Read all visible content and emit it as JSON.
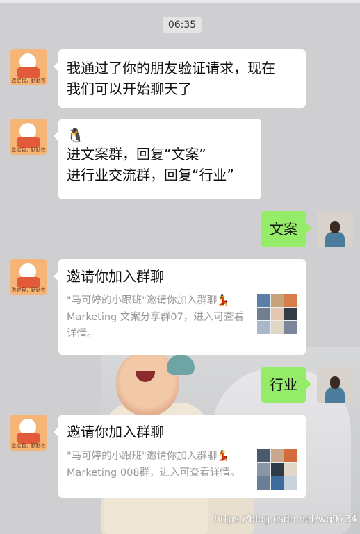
{
  "timestamp": "06:35",
  "messages": {
    "m1": {
      "line1": "我通过了你的朋友验证请求，现在",
      "line2": "我们可以开始聊天了"
    },
    "m2": {
      "emoji": "🐧",
      "line1": "进文案群，回复“文案”",
      "line2": "进行业交流群，回复“行业”"
    },
    "m3": {
      "text": "文案"
    },
    "m4": {
      "title": "邀请你加入群聊",
      "line1": "\"马可婷的小跟班\"邀请你加入群聊💃",
      "line2": "Marketing 文案分享群07，进入可查看",
      "line3": "详情。"
    },
    "m5": {
      "text": "行业"
    },
    "m6": {
      "title": "邀请你加入群聊",
      "line1": "\"马可婷的小跟班\"邀请你加入群聊💃",
      "line2": "Marketing 008群，进入可查看详情。"
    }
  },
  "bot_avatar_tag": "选定我，勤勤衣",
  "watermark": "https://blog.csdn.net/wq9734",
  "colors": {
    "bubble_green": "#95ec69",
    "bubble_white": "#ffffff",
    "background": "#cfcfd1"
  },
  "icons": {
    "group_thumb": "group-thumbnail-grid"
  }
}
